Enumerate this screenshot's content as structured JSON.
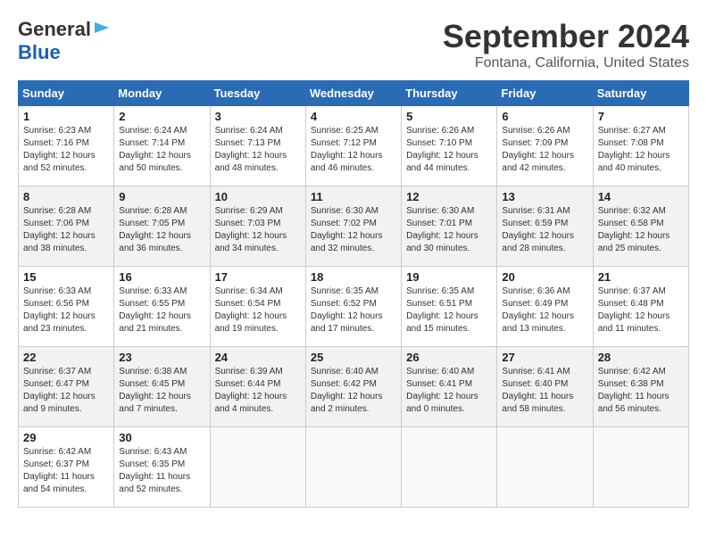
{
  "header": {
    "logo_general": "General",
    "logo_blue": "Blue",
    "month_title": "September 2024",
    "location": "Fontana, California, United States"
  },
  "calendar": {
    "days_of_week": [
      "Sunday",
      "Monday",
      "Tuesday",
      "Wednesday",
      "Thursday",
      "Friday",
      "Saturday"
    ],
    "weeks": [
      [
        {
          "day": "1",
          "sunrise": "6:23 AM",
          "sunset": "7:16 PM",
          "daylight": "12 hours and 52 minutes."
        },
        {
          "day": "2",
          "sunrise": "6:24 AM",
          "sunset": "7:14 PM",
          "daylight": "12 hours and 50 minutes."
        },
        {
          "day": "3",
          "sunrise": "6:24 AM",
          "sunset": "7:13 PM",
          "daylight": "12 hours and 48 minutes."
        },
        {
          "day": "4",
          "sunrise": "6:25 AM",
          "sunset": "7:12 PM",
          "daylight": "12 hours and 46 minutes."
        },
        {
          "day": "5",
          "sunrise": "6:26 AM",
          "sunset": "7:10 PM",
          "daylight": "12 hours and 44 minutes."
        },
        {
          "day": "6",
          "sunrise": "6:26 AM",
          "sunset": "7:09 PM",
          "daylight": "12 hours and 42 minutes."
        },
        {
          "day": "7",
          "sunrise": "6:27 AM",
          "sunset": "7:08 PM",
          "daylight": "12 hours and 40 minutes."
        }
      ],
      [
        {
          "day": "8",
          "sunrise": "6:28 AM",
          "sunset": "7:06 PM",
          "daylight": "12 hours and 38 minutes."
        },
        {
          "day": "9",
          "sunrise": "6:28 AM",
          "sunset": "7:05 PM",
          "daylight": "12 hours and 36 minutes."
        },
        {
          "day": "10",
          "sunrise": "6:29 AM",
          "sunset": "7:03 PM",
          "daylight": "12 hours and 34 minutes."
        },
        {
          "day": "11",
          "sunrise": "6:30 AM",
          "sunset": "7:02 PM",
          "daylight": "12 hours and 32 minutes."
        },
        {
          "day": "12",
          "sunrise": "6:30 AM",
          "sunset": "7:01 PM",
          "daylight": "12 hours and 30 minutes."
        },
        {
          "day": "13",
          "sunrise": "6:31 AM",
          "sunset": "6:59 PM",
          "daylight": "12 hours and 28 minutes."
        },
        {
          "day": "14",
          "sunrise": "6:32 AM",
          "sunset": "6:58 PM",
          "daylight": "12 hours and 25 minutes."
        }
      ],
      [
        {
          "day": "15",
          "sunrise": "6:33 AM",
          "sunset": "6:56 PM",
          "daylight": "12 hours and 23 minutes."
        },
        {
          "day": "16",
          "sunrise": "6:33 AM",
          "sunset": "6:55 PM",
          "daylight": "12 hours and 21 minutes."
        },
        {
          "day": "17",
          "sunrise": "6:34 AM",
          "sunset": "6:54 PM",
          "daylight": "12 hours and 19 minutes."
        },
        {
          "day": "18",
          "sunrise": "6:35 AM",
          "sunset": "6:52 PM",
          "daylight": "12 hours and 17 minutes."
        },
        {
          "day": "19",
          "sunrise": "6:35 AM",
          "sunset": "6:51 PM",
          "daylight": "12 hours and 15 minutes."
        },
        {
          "day": "20",
          "sunrise": "6:36 AM",
          "sunset": "6:49 PM",
          "daylight": "12 hours and 13 minutes."
        },
        {
          "day": "21",
          "sunrise": "6:37 AM",
          "sunset": "6:48 PM",
          "daylight": "12 hours and 11 minutes."
        }
      ],
      [
        {
          "day": "22",
          "sunrise": "6:37 AM",
          "sunset": "6:47 PM",
          "daylight": "12 hours and 9 minutes."
        },
        {
          "day": "23",
          "sunrise": "6:38 AM",
          "sunset": "6:45 PM",
          "daylight": "12 hours and 7 minutes."
        },
        {
          "day": "24",
          "sunrise": "6:39 AM",
          "sunset": "6:44 PM",
          "daylight": "12 hours and 4 minutes."
        },
        {
          "day": "25",
          "sunrise": "6:40 AM",
          "sunset": "6:42 PM",
          "daylight": "12 hours and 2 minutes."
        },
        {
          "day": "26",
          "sunrise": "6:40 AM",
          "sunset": "6:41 PM",
          "daylight": "12 hours and 0 minutes."
        },
        {
          "day": "27",
          "sunrise": "6:41 AM",
          "sunset": "6:40 PM",
          "daylight": "11 hours and 58 minutes."
        },
        {
          "day": "28",
          "sunrise": "6:42 AM",
          "sunset": "6:38 PM",
          "daylight": "11 hours and 56 minutes."
        }
      ],
      [
        {
          "day": "29",
          "sunrise": "6:42 AM",
          "sunset": "6:37 PM",
          "daylight": "11 hours and 54 minutes."
        },
        {
          "day": "30",
          "sunrise": "6:43 AM",
          "sunset": "6:35 PM",
          "daylight": "11 hours and 52 minutes."
        },
        null,
        null,
        null,
        null,
        null
      ]
    ]
  }
}
